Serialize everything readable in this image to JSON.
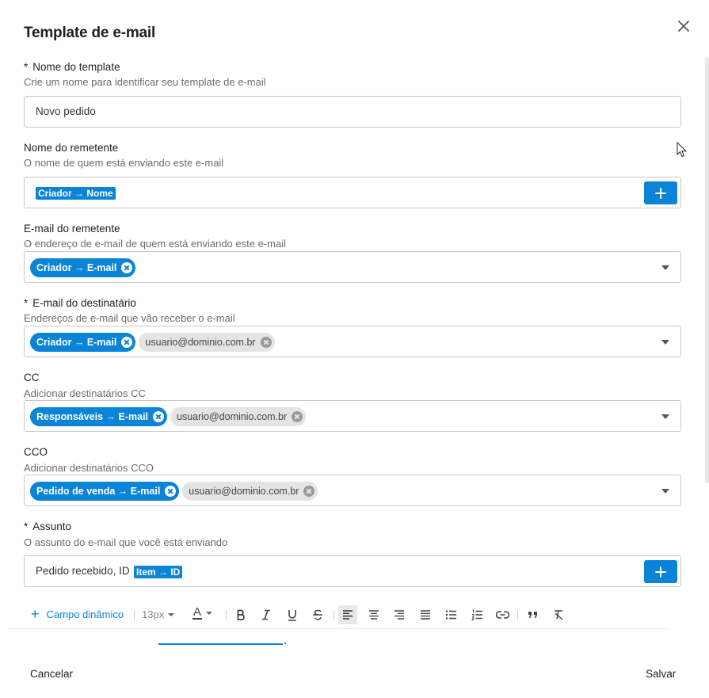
{
  "dialog": {
    "title": "Template de e-mail",
    "close_icon": "close-icon"
  },
  "colors": {
    "accent": "#0a84d6",
    "chip_gray": "#e4e4e4",
    "border": "#c9c9c9"
  },
  "fields": {
    "template_name": {
      "required_mark": "*",
      "label": "Nome do template",
      "help": "Crie um nome para identificar seu template de e-mail",
      "value": "Novo pedido"
    },
    "sender_name": {
      "label": "Nome do remetente",
      "help": "O nome de quem está enviando este e-mail",
      "tag": "Criador → Nome"
    },
    "sender_email": {
      "label": "E-mail do remetente",
      "help": "O endereço de e-mail de quem está enviando este e-mail",
      "chips": [
        "Criador → E-mail"
      ]
    },
    "recipient_email": {
      "required_mark": "*",
      "label": "E-mail do destinatário",
      "help": "Endereços de e-mail que vão receber o e-mail",
      "chips": [
        "Criador → E-mail",
        "usuario@dominio.com.br"
      ]
    },
    "cc": {
      "label": "CC",
      "help": "Adicionar destinatários CC",
      "chips": [
        "Responsáveis → E-mail",
        "usuario@dominio.com.br"
      ]
    },
    "cco": {
      "label": "CCO",
      "help": "Adicionar destinatários CCO",
      "chips": [
        "Pedido de venda → E-mail",
        "usuario@dominio.com.br"
      ]
    },
    "subject": {
      "required_mark": "*",
      "label": "Assunto",
      "help": "O assunto do e-mail que você está enviando",
      "value": "Pedido recebido, ID",
      "tag": "Item → ID"
    }
  },
  "toolbar": {
    "dynamic_field_label": "Campo dinâmico",
    "font_size": "13px",
    "text_color_letter": "A",
    "icons": [
      "bold-icon",
      "italic-icon",
      "underline-icon",
      "strikethrough-icon",
      "align-left-icon",
      "align-center-icon",
      "align-right-icon",
      "align-justify-icon",
      "bullet-list-icon",
      "numbered-list-icon",
      "link-icon",
      "quote-icon",
      "clear-format-icon"
    ]
  },
  "footer": {
    "cancel_label": "Cancelar",
    "save_label": "Salvar"
  }
}
